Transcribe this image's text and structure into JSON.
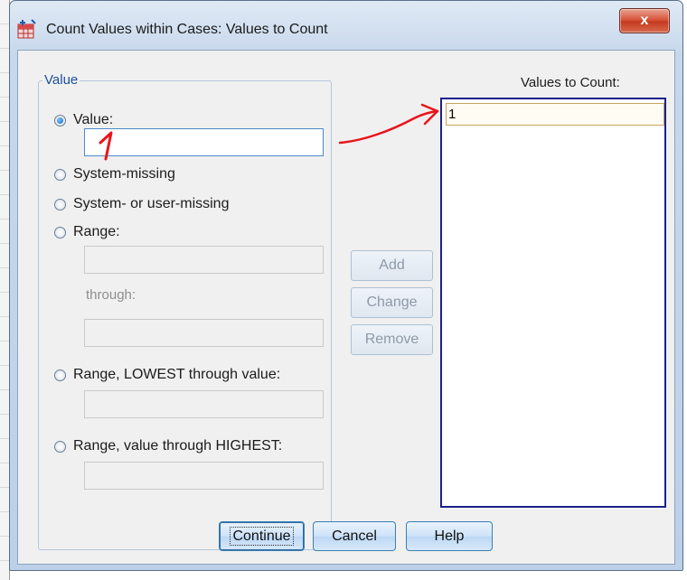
{
  "window": {
    "title": "Count Values within Cases: Values to Count",
    "close_glyph": "x"
  },
  "value_group": {
    "label": "Value",
    "options": {
      "value": "Value:",
      "system_missing": "System-missing",
      "system_or_user_missing": "System- or user-missing",
      "range": "Range:",
      "through": "through:",
      "range_lowest": "Range, LOWEST through value:",
      "range_highest": "Range, value through HIGHEST:"
    },
    "selected": "value"
  },
  "middle_buttons": {
    "add": "Add",
    "change": "Change",
    "remove": "Remove"
  },
  "values_to_count": {
    "label": "Values to Count:",
    "items": [
      "1"
    ]
  },
  "footer": {
    "continue": "Continue",
    "cancel": "Cancel",
    "help": "Help"
  },
  "colors": {
    "group_label": "#1c4f9c",
    "list_border": "#1d1f8c",
    "annotation": "#e8141a",
    "close_button": "#c53a1f"
  }
}
